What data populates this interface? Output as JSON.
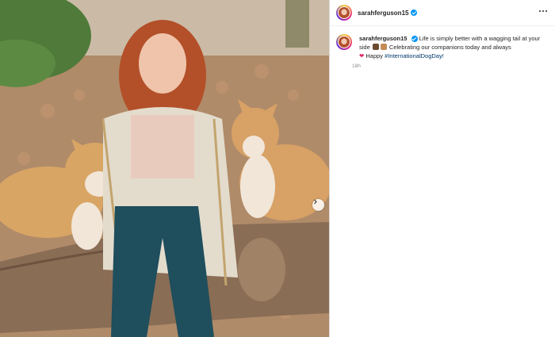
{
  "post": {
    "author": "sarahferguson15",
    "caption_before": " Life is simply better with a wagging tail at your side ",
    "caption_middle": " Celebrating our companions today and always ",
    "caption_end": " Happy ",
    "hashtag": "#InternationalDogDay!",
    "timestamp": "18h",
    "heart_emoji": "❤"
  },
  "icons": {
    "verified": "verified-badge-icon",
    "more": "more-options-icon",
    "next": "chevron-right-icon"
  },
  "colors": {
    "verified": "#0095f6",
    "hashtag": "#00376b",
    "heart": "#e0245e"
  }
}
